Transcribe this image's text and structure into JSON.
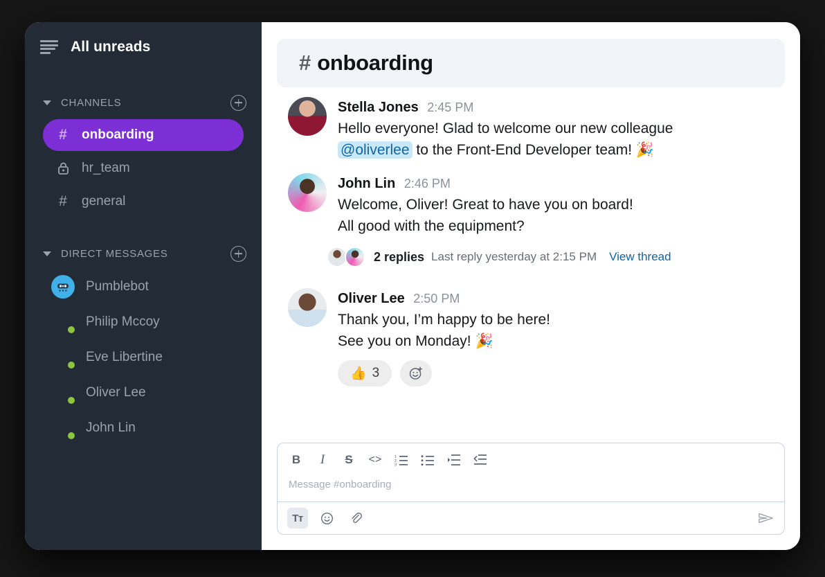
{
  "sidebar": {
    "header": {
      "title": "All unreads",
      "menu_icon": "hamburger-menu-icon"
    },
    "channels_section": {
      "label": "CHANNELS",
      "add_icon": "plus-circle-icon",
      "chevron": "chevron-down-icon"
    },
    "channels": [
      {
        "name": "onboarding",
        "icon": "hash-icon",
        "active": true
      },
      {
        "name": "hr_team",
        "icon": "lock-icon",
        "active": false
      },
      {
        "name": "general",
        "icon": "hash-icon",
        "active": false
      }
    ],
    "dm_section": {
      "label": "DIRECT MESSAGES",
      "add_icon": "plus-circle-icon",
      "chevron": "chevron-down-icon"
    },
    "direct_messages": [
      {
        "name": "Pumblebot",
        "online": false,
        "avatar": "bot-avatar"
      },
      {
        "name": "Philip Mccoy",
        "online": true,
        "avatar": "photo-avatar"
      },
      {
        "name": "Eve Libertine",
        "online": true,
        "avatar": "photo-avatar"
      },
      {
        "name": "Oliver Lee",
        "online": true,
        "avatar": "photo-avatar"
      },
      {
        "name": "John Lin",
        "online": true,
        "avatar": "photo-avatar"
      }
    ]
  },
  "channel": {
    "hash": "#",
    "name": "onboarding"
  },
  "messages": [
    {
      "author": "Stella Jones",
      "time": "2:45 PM",
      "line1": "Hello everyone! Glad to welcome our new colleague",
      "mention": "@oliverlee",
      "line2_rest": " to the Front-End Developer team! 🎉"
    },
    {
      "author": "John Lin",
      "time": "2:46 PM",
      "line1": "Welcome, Oliver! Great to have you on board!",
      "line2": "All good with the equipment?",
      "thread": {
        "count": "2 replies",
        "last_reply": "Last reply yesterday at 2:15 PM",
        "view_link": "View thread"
      }
    },
    {
      "author": "Oliver Lee",
      "time": "2:50 PM",
      "line1": "Thank you, I’m happy to be here!",
      "line2": "See you on Monday! 🎉",
      "reactions": [
        {
          "emoji": "👍",
          "count": "3"
        }
      ],
      "add_reaction_icon": "add-reaction-icon"
    }
  ],
  "composer": {
    "placeholder": "Message #onboarding",
    "toolbar": [
      {
        "name": "bold-icon",
        "label": "B"
      },
      {
        "name": "italic-icon",
        "label": "I"
      },
      {
        "name": "strikethrough-icon",
        "label": "S"
      },
      {
        "name": "code-icon",
        "label": "<>"
      },
      {
        "name": "ordered-list-icon",
        "label": ""
      },
      {
        "name": "bulleted-list-icon",
        "label": ""
      },
      {
        "name": "blockquote-icon",
        "label": ""
      },
      {
        "name": "code-block-icon",
        "label": ""
      }
    ],
    "bottom_bar": [
      {
        "name": "format-text-icon",
        "label": "Tᴛ",
        "selected": true
      },
      {
        "name": "emoji-icon",
        "label": ""
      },
      {
        "name": "attachment-icon",
        "label": ""
      }
    ],
    "send_icon": "send-icon"
  },
  "colors": {
    "sidebar_bg": "#222b36",
    "accent_purple": "#7B2FD4",
    "header_bg": "#F1F4F8",
    "mention_bg": "#C9E8F8",
    "mention_fg": "#1264A3",
    "link": "#1264A3",
    "online_green": "#8CC63F",
    "page_bg": "#161616"
  }
}
